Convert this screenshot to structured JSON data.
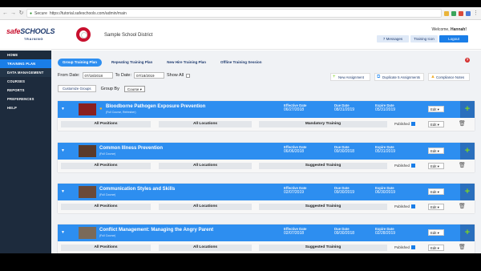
{
  "browser": {
    "secure": "Secure",
    "url": "https://tutorial.safeschools.com/admin/main"
  },
  "header": {
    "logo_safe": "safe",
    "logo_schools": "SCHOOLS",
    "logo_sub": "TRAINING",
    "district": "Sample School District",
    "welcome_prefix": "Welcome,",
    "welcome_name": "Hannah!",
    "messages": "7 Messages",
    "training_icon": "Training Icon",
    "logout": "Logout"
  },
  "sidebar": {
    "items": [
      {
        "label": "HOME"
      },
      {
        "label": "TRAINING PLAN"
      },
      {
        "label": "DATA MANAGEMENT"
      },
      {
        "label": "COURSES"
      },
      {
        "label": "REPORTS"
      },
      {
        "label": "PREFERENCES"
      },
      {
        "label": "HELP"
      }
    ]
  },
  "tabs": [
    {
      "label": "Group Training Plan"
    },
    {
      "label": "Repeating Training Plan"
    },
    {
      "label": "New Hire Training Plan"
    },
    {
      "label": "Offline Training Session"
    }
  ],
  "filters": {
    "from_label": "From Date:",
    "from_value": "07/18/2018",
    "to_label": "To Date:",
    "to_value": "07/18/2019",
    "show_all": "Show All",
    "customize": "Customize Groups",
    "group_by_label": "Group By",
    "group_by_value": "Course"
  },
  "actions": {
    "new_assignment": "New Assignment",
    "duplicate": "Duplicate 5 Assignments",
    "compliance": "Compliance Notes"
  },
  "column_labels": {
    "effective": "Effective Date",
    "due": "Due Date",
    "expire": "Expire Date",
    "edit": "Edit",
    "published": "Published"
  },
  "assignments": [
    {
      "title": "Bloodborne Pathogen Exposure Prevention",
      "subtitle": "(Full Course, Refresher)",
      "effective": "06/27/2018",
      "due": "08/31/2019",
      "expire": "05/31/2019",
      "positions": "All Positions",
      "locations": "All Locations",
      "type": "Mandatory Training"
    },
    {
      "title": "Common Illness Prevention",
      "subtitle": "(Full Course)",
      "effective": "06/06/2018",
      "due": "09/30/2018",
      "expire": "05/31/2019",
      "positions": "All Positions",
      "locations": "All Locations",
      "type": "Suggested Training"
    },
    {
      "title": "Communication Styles and Skills",
      "subtitle": "(Full Course)",
      "effective": "02/07/2019",
      "due": "09/30/2019",
      "expire": "06/30/2019",
      "positions": "All Positions",
      "locations": "All Locations",
      "type": "Suggested Training"
    },
    {
      "title": "Conflict Management: Managing the Angry Parent",
      "subtitle": "(Full Course)",
      "effective": "02/07/2018",
      "due": "09/30/2018",
      "expire": "02/28/2019",
      "positions": "All Positions",
      "locations": "All Locations",
      "type": "Suggested Training"
    }
  ],
  "colors": {
    "accent": "#2d8ef0",
    "sidebar": "#1d2b3d",
    "brand_red": "#c8102e",
    "brand_navy": "#1f3b6f"
  }
}
